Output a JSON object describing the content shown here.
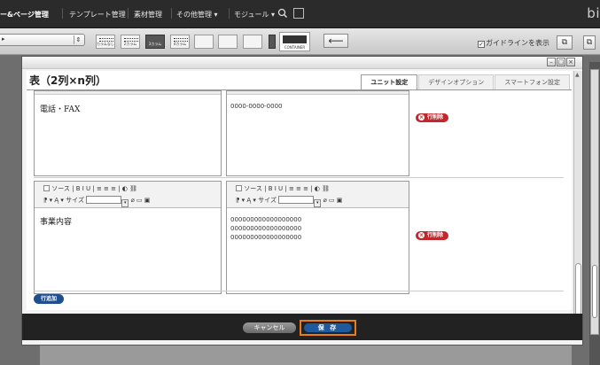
{
  "nav": {
    "items": [
      "ー&ページ管理",
      "テンプレート管理",
      "素材管理",
      "その他管理 ▾",
      "モジュール ▾"
    ],
    "brand": "bi"
  },
  "toolbar": {
    "tile_captions": [
      "カラムなし",
      "2カラム",
      "3カラム",
      "4カラム",
      "",
      "",
      ""
    ],
    "big_caption": "CONTAINER",
    "arrow": "⟵",
    "guideline_label": "ガイドラインを表示",
    "guideline_checked": true
  },
  "dialog": {
    "title": "表（2列×n列）",
    "tabs": [
      "ユニット設定",
      "デザインオプション",
      "スマートフォン設定"
    ],
    "active_tab": "ユニット設定",
    "rows": [
      {
        "label": "電話・FAX",
        "values": [
          "0000-0000-0000"
        ],
        "delete_label": "行削除"
      },
      {
        "label": "事業内容",
        "values": [
          "000000000000000000",
          "000000000000000000",
          "000000000000000000"
        ],
        "delete_label": "行削除"
      }
    ],
    "editor_toolbar": {
      "line1": "ソース | B  I  U | ≡ ≡ ≡ | ◐ ⛓",
      "line2_prefix": "⁋ ▾ Ą ▾ サイズ",
      "line2_suffix": "⌀ ▭ ▣"
    },
    "add_row_label": "行追加",
    "cancel_label": "キャンセル",
    "save_label": "保 存",
    "window_buttons": [
      "–",
      "□",
      "×"
    ]
  },
  "colors": {
    "nav_bg": "#2b2b2b",
    "delete_red": "#c0282d",
    "primary_blue": "#1f5a9e",
    "highlight_orange": "#e87d1e"
  }
}
